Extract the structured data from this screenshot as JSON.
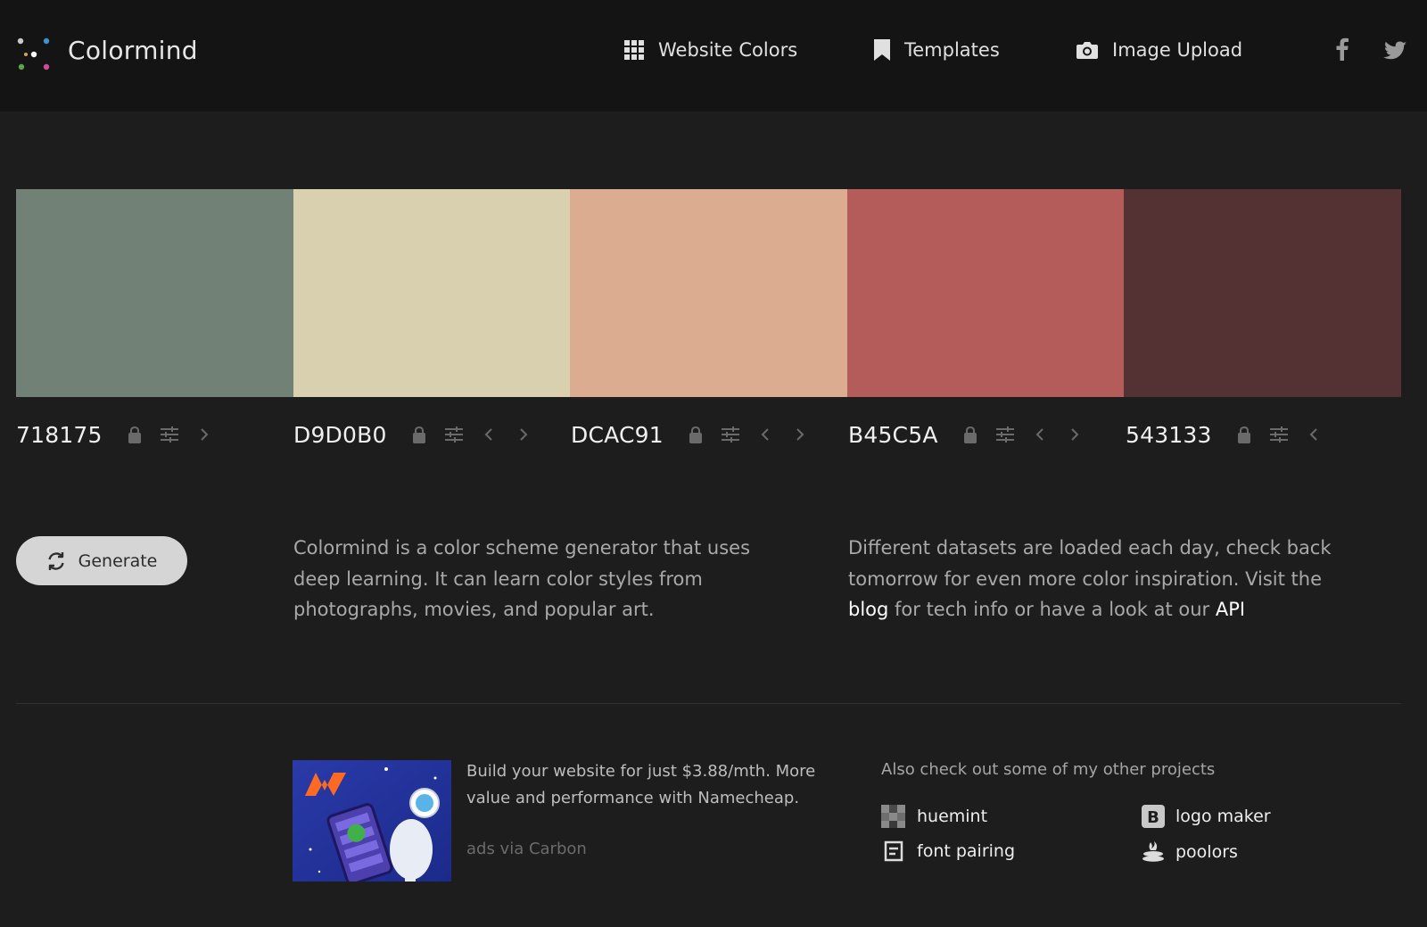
{
  "header": {
    "brand": "Colormind",
    "nav": [
      {
        "label": "Website Colors",
        "icon": "grid-icon"
      },
      {
        "label": "Templates",
        "icon": "bookmark-icon"
      },
      {
        "label": "Image Upload",
        "icon": "camera-icon"
      }
    ],
    "social": [
      "facebook-icon",
      "twitter-icon"
    ]
  },
  "palette": [
    {
      "hex": "718175",
      "color": "#718175",
      "controls": [
        "lock-icon",
        "adjust-icon",
        "arrow-right-icon"
      ]
    },
    {
      "hex": "D9D0B0",
      "color": "#D9D0B0",
      "controls": [
        "lock-icon",
        "adjust-icon",
        "arrow-left-icon",
        "arrow-right-icon"
      ]
    },
    {
      "hex": "DCAC91",
      "color": "#DCAC91",
      "controls": [
        "lock-icon",
        "adjust-icon",
        "arrow-left-icon",
        "arrow-right-icon"
      ]
    },
    {
      "hex": "B45C5A",
      "color": "#B45C5A",
      "controls": [
        "lock-icon",
        "adjust-icon",
        "arrow-left-icon",
        "arrow-right-icon"
      ]
    },
    {
      "hex": "543133",
      "color": "#543133",
      "controls": [
        "lock-icon",
        "adjust-icon",
        "arrow-left-icon"
      ]
    }
  ],
  "generate": {
    "label": "Generate"
  },
  "description": {
    "left": "Colormind is a color scheme generator that uses deep learning. It can learn color styles from photographs, movies, and popular art.",
    "right_before": "Different datasets are loaded each day, check back tomorrow for even more color inspiration. Visit the ",
    "blog_link": "blog",
    "right_middle": " for tech info or have a look at our ",
    "api_link": "API"
  },
  "ad": {
    "text": "Build your website for just $3.88/mth. More value and performance with Namecheap.",
    "via": "ads via Carbon"
  },
  "projects": {
    "title": "Also check out some of my other projects",
    "items": [
      {
        "label": "huemint",
        "icon": "huemint-icon"
      },
      {
        "label": "logo maker",
        "icon": "logo-maker-icon"
      },
      {
        "label": "font pairing",
        "icon": "font-pairing-icon"
      },
      {
        "label": "poolors",
        "icon": "poolors-icon"
      }
    ]
  },
  "colors": {
    "background": "#1d1d1e",
    "header": "#141414",
    "button": "#d5d5d5"
  }
}
